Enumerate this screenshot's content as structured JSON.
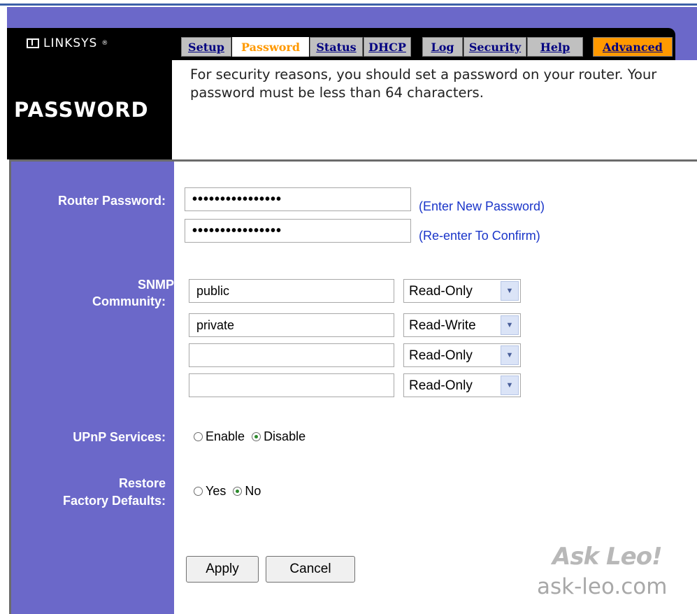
{
  "brand": {
    "logo_text": "LINKSYS",
    "trademark": "®"
  },
  "tabs": [
    {
      "label": "Setup",
      "active": false
    },
    {
      "label": "Password",
      "active": true
    },
    {
      "label": "Status",
      "active": false
    },
    {
      "label": "DHCP",
      "active": false
    },
    {
      "label": "Log",
      "active": false
    },
    {
      "label": "Security",
      "active": false
    },
    {
      "label": "Help",
      "active": false
    },
    {
      "label": "Advanced",
      "active": false
    }
  ],
  "page": {
    "title": "PASSWORD",
    "description": "For security reasons, you should set a password on your router. Your password must be less than 64 characters."
  },
  "router_password": {
    "label": "Router Password:",
    "value": "••••••••••••••••",
    "confirm_value": "••••••••••••••••",
    "hint_new": "(Enter New Password)",
    "hint_confirm": "(Re-enter To Confirm)"
  },
  "snmp": {
    "label_line1": "SNMP",
    "label_line2": "Community:",
    "rows": [
      {
        "community": "public",
        "access": "Read-Only"
      },
      {
        "community": "private",
        "access": "Read-Write"
      },
      {
        "community": "",
        "access": "Read-Only"
      },
      {
        "community": "",
        "access": "Read-Only"
      }
    ]
  },
  "upnp": {
    "label": "UPnP Services:",
    "options": [
      "Enable",
      "Disable"
    ],
    "selected": "Disable"
  },
  "restore": {
    "label_line1": "Restore",
    "label_line2": "Factory Defaults:",
    "options": [
      "Yes",
      "No"
    ],
    "selected": "No"
  },
  "buttons": {
    "apply": "Apply",
    "cancel": "Cancel"
  },
  "watermark": {
    "line1": "Ask Leo!",
    "line2": "ask-leo.com"
  },
  "colors": {
    "sidebar": "#6b68c9",
    "header_black": "#000000",
    "active_tab_text": "#ff9900",
    "advanced_tab_bg": "#ff9900",
    "hint_text": "#1a35c9"
  }
}
